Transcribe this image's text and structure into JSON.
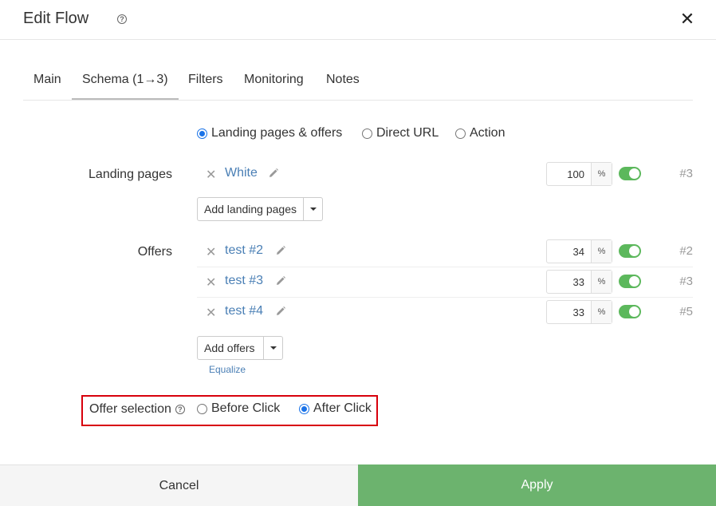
{
  "dialog": {
    "title": "Edit Flow",
    "help_glyph": "?",
    "close_glyph": "✕"
  },
  "tabs": [
    {
      "label": "Main"
    },
    {
      "label": "Schema (1→3)"
    },
    {
      "label": "Filters"
    },
    {
      "label": "Monitoring"
    },
    {
      "label": "Notes"
    }
  ],
  "active_tab": "Schema (1→3)",
  "schema_type": {
    "options": [
      "Landing pages & offers",
      "Direct URL",
      "Action"
    ],
    "selected": "Landing pages & offers"
  },
  "landing_pages": {
    "label": "Landing pages",
    "items": [
      {
        "name": "White",
        "weight": "100",
        "unit": "%",
        "enabled": true,
        "id": "#3"
      }
    ],
    "add_label": "Add landing pages"
  },
  "offers": {
    "label": "Offers",
    "items": [
      {
        "name": "test #2",
        "weight": "34",
        "unit": "%",
        "enabled": true,
        "id": "#2"
      },
      {
        "name": "test #3",
        "weight": "33",
        "unit": "%",
        "enabled": true,
        "id": "#3"
      },
      {
        "name": "test #4",
        "weight": "33",
        "unit": "%",
        "enabled": true,
        "id": "#5"
      }
    ],
    "add_label": "Add offers",
    "equalize_label": "Equalize"
  },
  "offer_selection": {
    "label": "Offer selection",
    "help_glyph": "?",
    "options": [
      "Before Click",
      "After Click"
    ],
    "selected": "After Click"
  },
  "footer": {
    "cancel_label": "Cancel",
    "apply_label": "Apply"
  },
  "colors": {
    "accent": "#1a73e8",
    "link": "#4a7fb5",
    "toggle_on": "#5cb85c",
    "apply": "#6cb36e",
    "highlight": "#d8000c"
  }
}
